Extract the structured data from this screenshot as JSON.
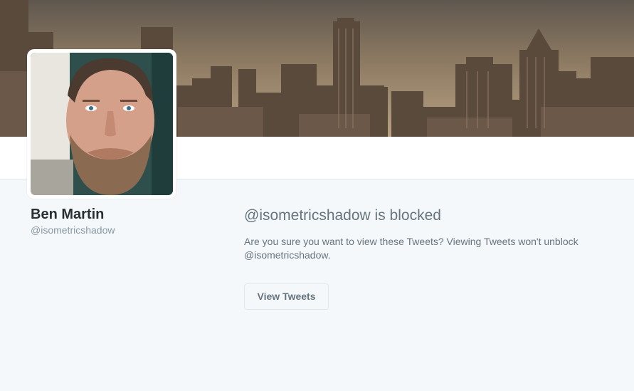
{
  "profile": {
    "name": "Ben Martin",
    "handle": "@isometricshadow"
  },
  "blocked": {
    "title": "@isometricshadow is blocked",
    "description": "Are you sure you want to view these Tweets? Viewing Tweets won't unblock @isometricshadow.",
    "view_button_label": "View Tweets"
  },
  "colors": {
    "page_background": "#f5f8fa",
    "name_text": "#292f33",
    "secondary_text": "#66757f",
    "handle_text": "#8899a6",
    "border": "#e1e8ed"
  }
}
